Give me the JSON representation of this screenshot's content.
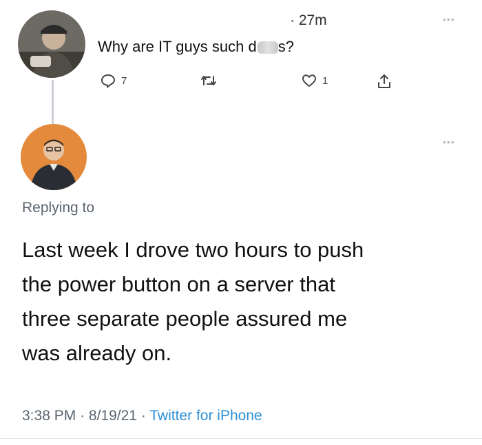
{
  "parent_tweet": {
    "timestamp": "· 27m",
    "text_before": "Why are IT guys such d",
    "text_after": "s?",
    "counts": {
      "replies": "7",
      "likes": "1"
    }
  },
  "reply_tweet": {
    "replying_to": "Replying to",
    "lines": [
      "Last week I drove two hours to push",
      "the power button on a server that",
      "three separate people assured me",
      "was already on."
    ],
    "time": "3:38 PM",
    "date": "8/19/21",
    "source": "Twitter for iPhone"
  },
  "icons": {
    "more": "more-icon",
    "reply": "reply-icon",
    "retweet": "retweet-icon",
    "like": "like-icon",
    "share": "share-icon"
  },
  "colors": {
    "link": "#2d8fd6",
    "secondary_text": "#5b6570"
  }
}
